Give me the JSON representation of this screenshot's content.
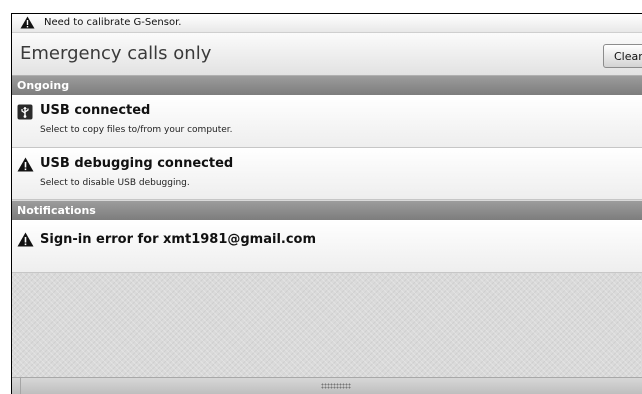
{
  "status_bar": {
    "message": "Need to calibrate G-Sensor.",
    "icon": "warning-icon"
  },
  "header": {
    "title": "Emergency calls only",
    "clear_button": "Clear"
  },
  "sections": {
    "ongoing": "Ongoing",
    "notifications": "Notifications"
  },
  "ongoing_items": [
    {
      "icon": "usb-icon",
      "title": "USB connected",
      "subtitle": "Select to copy files to/from your computer."
    },
    {
      "icon": "warning-icon",
      "title": "USB debugging connected",
      "subtitle": "Select to disable USB debugging."
    }
  ],
  "notification_items": [
    {
      "icon": "warning-icon",
      "title": "Sign-in error for xmt1981@gmail.com"
    }
  ]
}
